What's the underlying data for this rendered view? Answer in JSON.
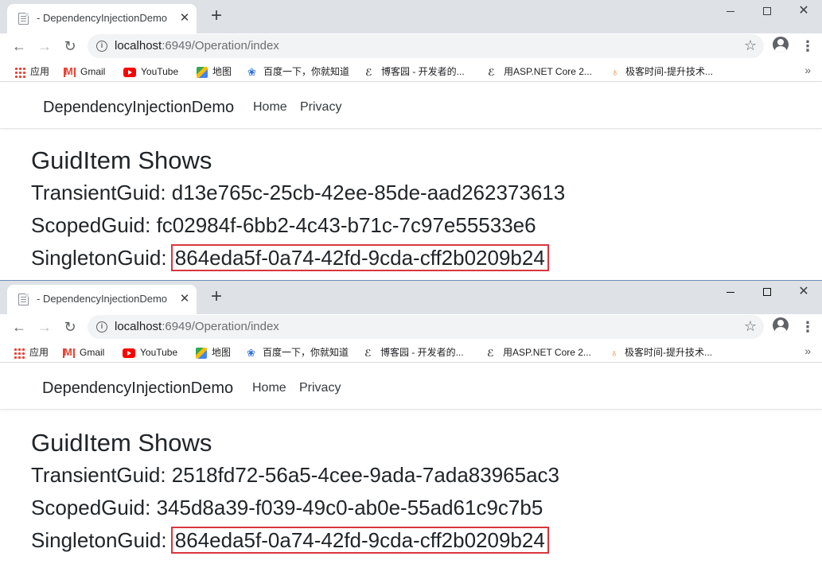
{
  "windows": [
    {
      "tab": {
        "title": "- DependencyInjectionDemo",
        "close": "✕"
      },
      "new_tab": "+",
      "address": {
        "host": "localhost",
        "path": ":6949/Operation/index"
      },
      "bookmarks": [
        "应用",
        "Gmail",
        "YouTube",
        "地图",
        "百度一下，你就知道",
        "博客园 - 开发者的...",
        "用ASP.NET Core 2...",
        "极客时间-提升技术..."
      ],
      "site": {
        "brand": "DependencyInjectionDemo",
        "nav": [
          "Home",
          "Privacy"
        ],
        "heading": "GuidItem Shows",
        "rows": [
          {
            "label": "TransientGuid: ",
            "value": "d13e765c-25cb-42ee-85de-aad262373613"
          },
          {
            "label": "ScopedGuid: ",
            "value": "fc02984f-6bb2-4c43-b71c-7c97e55533e6"
          },
          {
            "label": "SingletonGuid: ",
            "value": "864eda5f-0a74-42fd-9cda-cff2b0209b24"
          }
        ]
      }
    },
    {
      "tab": {
        "title": "- DependencyInjectionDemo",
        "close": "✕"
      },
      "new_tab": "+",
      "address": {
        "host": "localhost",
        "path": ":6949/Operation/index"
      },
      "bookmarks": [
        "应用",
        "Gmail",
        "YouTube",
        "地图",
        "百度一下，你就知道",
        "博客园 - 开发者的...",
        "用ASP.NET Core 2...",
        "极客时间-提升技术..."
      ],
      "site": {
        "brand": "DependencyInjectionDemo",
        "nav": [
          "Home",
          "Privacy"
        ],
        "heading": "GuidItem Shows",
        "rows": [
          {
            "label": "TransientGuid: ",
            "value": "2518fd72-56a5-4cee-9ada-7ada83965ac3"
          },
          {
            "label": "ScopedGuid: ",
            "value": "345d8a39-f039-49c0-ab0e-55ad61c9c7b5"
          },
          {
            "label": "SingletonGuid: ",
            "value": "864eda5f-0a74-42fd-9cda-cff2b0209b24"
          }
        ]
      }
    }
  ],
  "highlight_color": "#d9363e",
  "icons": {
    "back": "arrow-left-icon",
    "forward": "arrow-right-icon",
    "reload": "reload-icon",
    "info": "info-icon",
    "star": "star-icon",
    "account": "account-icon",
    "menu": "kebab-menu-icon"
  }
}
